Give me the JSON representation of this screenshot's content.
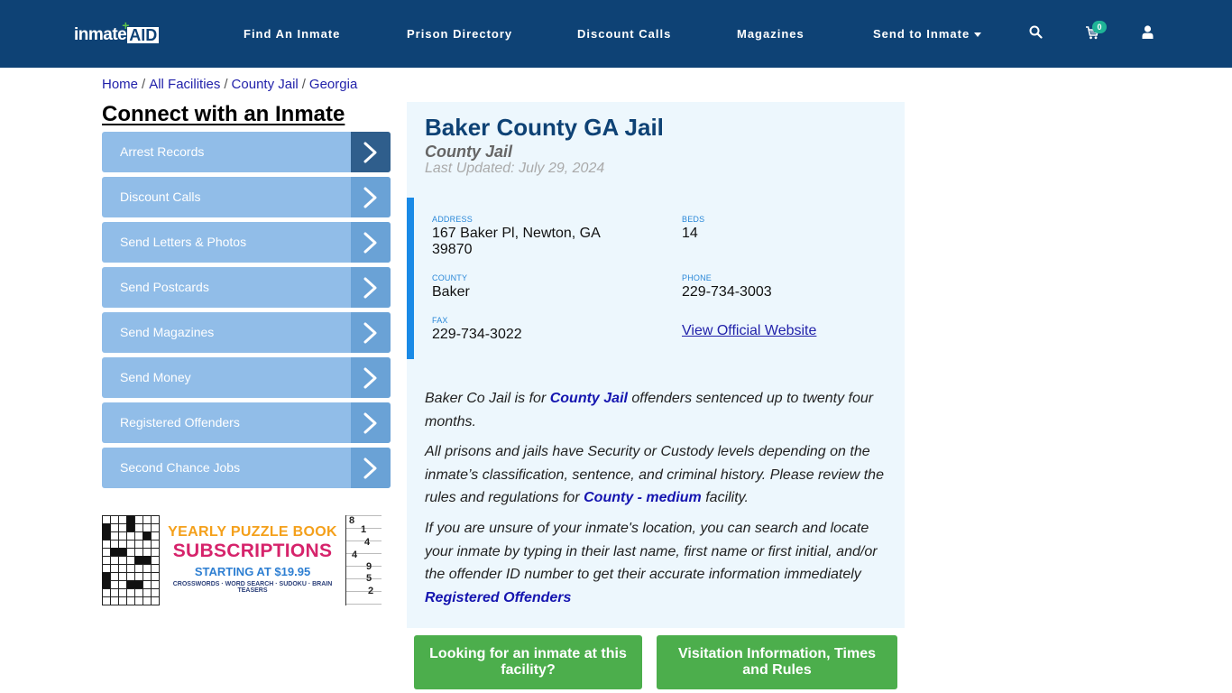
{
  "header": {
    "logo": {
      "part1": "inmate",
      "part2": "AID",
      "plus": "+"
    },
    "nav": [
      {
        "label": "Find An Inmate"
      },
      {
        "label": "Prison Directory"
      },
      {
        "label": "Discount Calls"
      },
      {
        "label": "Magazines"
      },
      {
        "label": "Send to Inmate",
        "has_dropdown": true
      }
    ],
    "icons": [
      "search-icon",
      "cart-icon",
      "user-icon"
    ],
    "cart_count": "0",
    "colors": {
      "bar": "#0e4275",
      "badge": "#1fb497"
    }
  },
  "breadcrumb": [
    {
      "label": "Home"
    },
    {
      "label": "All Facilities"
    },
    {
      "label": "County Jail"
    },
    {
      "label": "Georgia"
    }
  ],
  "breadcrumb_separator": "/",
  "sidebar": {
    "title": "Connect with an Inmate",
    "items": [
      {
        "label": "Arrest Records",
        "active": true
      },
      {
        "label": "Discount Calls"
      },
      {
        "label": "Send Letters & Photos"
      },
      {
        "label": "Send Postcards"
      },
      {
        "label": "Send Magazines"
      },
      {
        "label": "Send Money"
      },
      {
        "label": "Registered Offenders"
      },
      {
        "label": "Second Chance Jobs"
      }
    ],
    "ad": {
      "line1": "YEARLY PUZZLE BOOK",
      "line2": "SUBSCRIPTIONS",
      "line3": "STARTING AT $19.95",
      "line4": "CROSSWORDS · WORD SEARCH · SUDOKU · BRAIN TEASERS",
      "sudoku_digits": [
        "8",
        "1",
        "4",
        "4",
        "9",
        "5",
        "2"
      ]
    }
  },
  "facility": {
    "name": "Baker County GA Jail",
    "type": "County Jail",
    "last_updated": "Last Updated: July 29, 2024",
    "fields": {
      "address": {
        "label": "ADDRESS",
        "value_line1": "167 Baker Pl, Newton, GA",
        "value_line2": "39870"
      },
      "beds": {
        "label": "BEDS",
        "value": "14"
      },
      "county": {
        "label": "COUNTY",
        "value": "Baker"
      },
      "phone": {
        "label": "PHONE",
        "value": "229-734-3003"
      },
      "fax": {
        "label": "FAX",
        "value": "229-734-3022"
      }
    },
    "website_link": "View Official Website",
    "paragraphs": {
      "p1_before": "Baker Co Jail is for ",
      "p1_link": "County Jail",
      "p1_after": " offenders sentenced up to twenty four months.",
      "p2_before": "All prisons and jails have Security or Custody levels depending on the inmate’s classification, sentence, and criminal history. Please review the rules and regulations for ",
      "p2_link": "County - medium",
      "p2_after": " facility.",
      "p3_text": "If you are unsure of your inmate's location, you can search and locate your inmate by typing in their last name, first name or first initial, and/or the offender ID number to get their accurate information immediately",
      "p3_link": "Registered Offenders"
    }
  },
  "actions": {
    "find_inmate": "Looking for an inmate at this facility?",
    "visitation": "Visitation Information, Times and Rules",
    "color": "#4cae4c"
  }
}
